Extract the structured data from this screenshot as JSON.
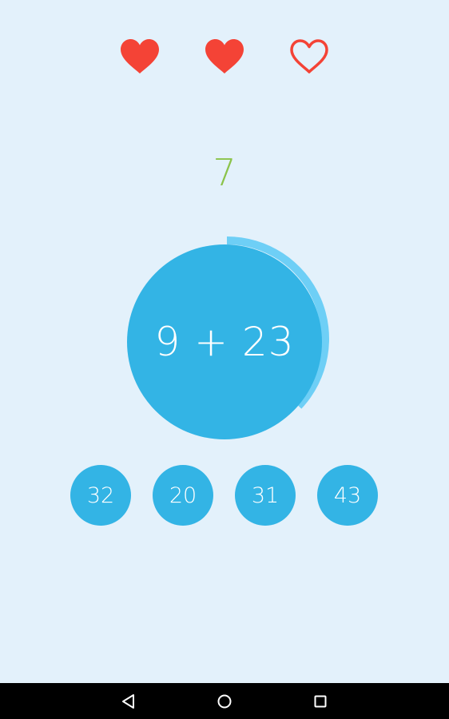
{
  "lives": {
    "total": 3,
    "remaining": 2,
    "filled_color": "#F44336",
    "icon": "heart-icon"
  },
  "score": {
    "value": "7",
    "color": "#8BC34A"
  },
  "question": {
    "text": "9 + 23",
    "timer_remaining_fraction": 0.37,
    "circle_color": "#33B4E5",
    "timer_color": "#6ECFF6"
  },
  "answers": [
    {
      "label": "32"
    },
    {
      "label": "20"
    },
    {
      "label": "31"
    },
    {
      "label": "43"
    }
  ],
  "navigation_bar": {
    "back_icon": "back-triangle-icon",
    "home_icon": "home-circle-icon",
    "recents_icon": "recents-square-icon"
  }
}
